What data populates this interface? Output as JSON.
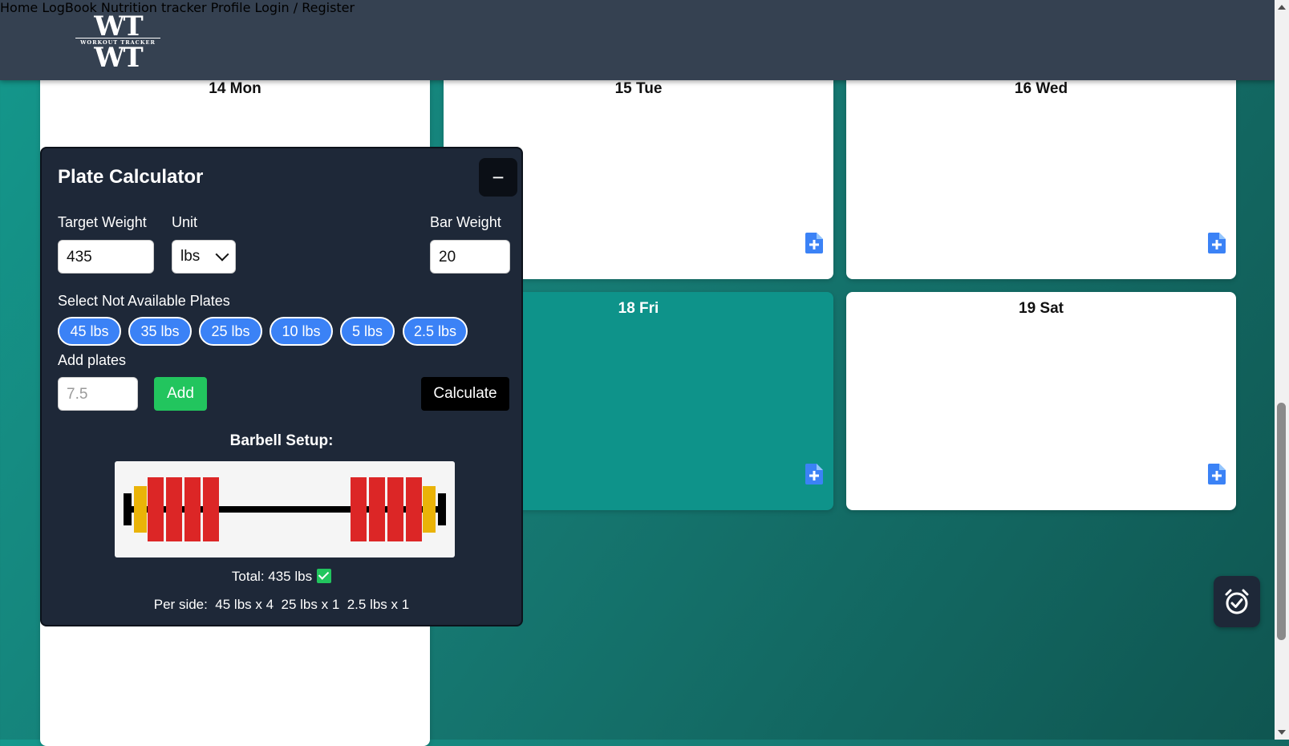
{
  "header": {
    "logo_text_top": "WT",
    "logo_subtitle": "WORKOUT TRACKER",
    "logo_text_bottom": "WT",
    "nav": [
      {
        "label": "Home"
      },
      {
        "label": "LogBook"
      },
      {
        "label": "Nutrition tracker"
      },
      {
        "label": "Profile"
      },
      {
        "label": "Login / Register"
      }
    ]
  },
  "days": [
    {
      "title": "14 Mon"
    },
    {
      "title": "15 Tue"
    },
    {
      "title": "16 Wed"
    },
    {
      "title": "18 Fri",
      "highlighted": true
    },
    {
      "title": "19 Sat"
    }
  ],
  "calculator": {
    "title": "Plate Calculator",
    "minimize_label": "−",
    "target_weight_label": "Target Weight",
    "target_weight_value": "435",
    "unit_label": "Unit",
    "unit_value": "lbs",
    "bar_weight_label": "Bar Weight",
    "bar_weight_value": "20",
    "not_available_label": "Select Not Available Plates",
    "plates": [
      "45 lbs",
      "35 lbs",
      "25 lbs",
      "10 lbs",
      "5 lbs",
      "2.5 lbs"
    ],
    "add_plates_label": "Add plates",
    "add_plates_placeholder": "7.5",
    "add_button": "Add",
    "calculate_button": "Calculate",
    "barbell_title": "Barbell Setup:",
    "total_text": "Total: 435 lbs",
    "per_side_text": "Per side:  45 lbs x 4  25 lbs x 1  2.5 lbs x 1",
    "colors": {
      "plate_45": "#dc2626",
      "plate_25": "#eab308",
      "bar": "#000000"
    }
  },
  "colors": {
    "header_bg": "#354151",
    "panel_bg": "#1e2838",
    "chip_blue": "#3b82f6",
    "add_green": "#22c55e",
    "card_teal": "#0e938a"
  },
  "icons": {
    "day_add": "file-plus-icon",
    "timer": "alarm-clock-check-icon"
  }
}
